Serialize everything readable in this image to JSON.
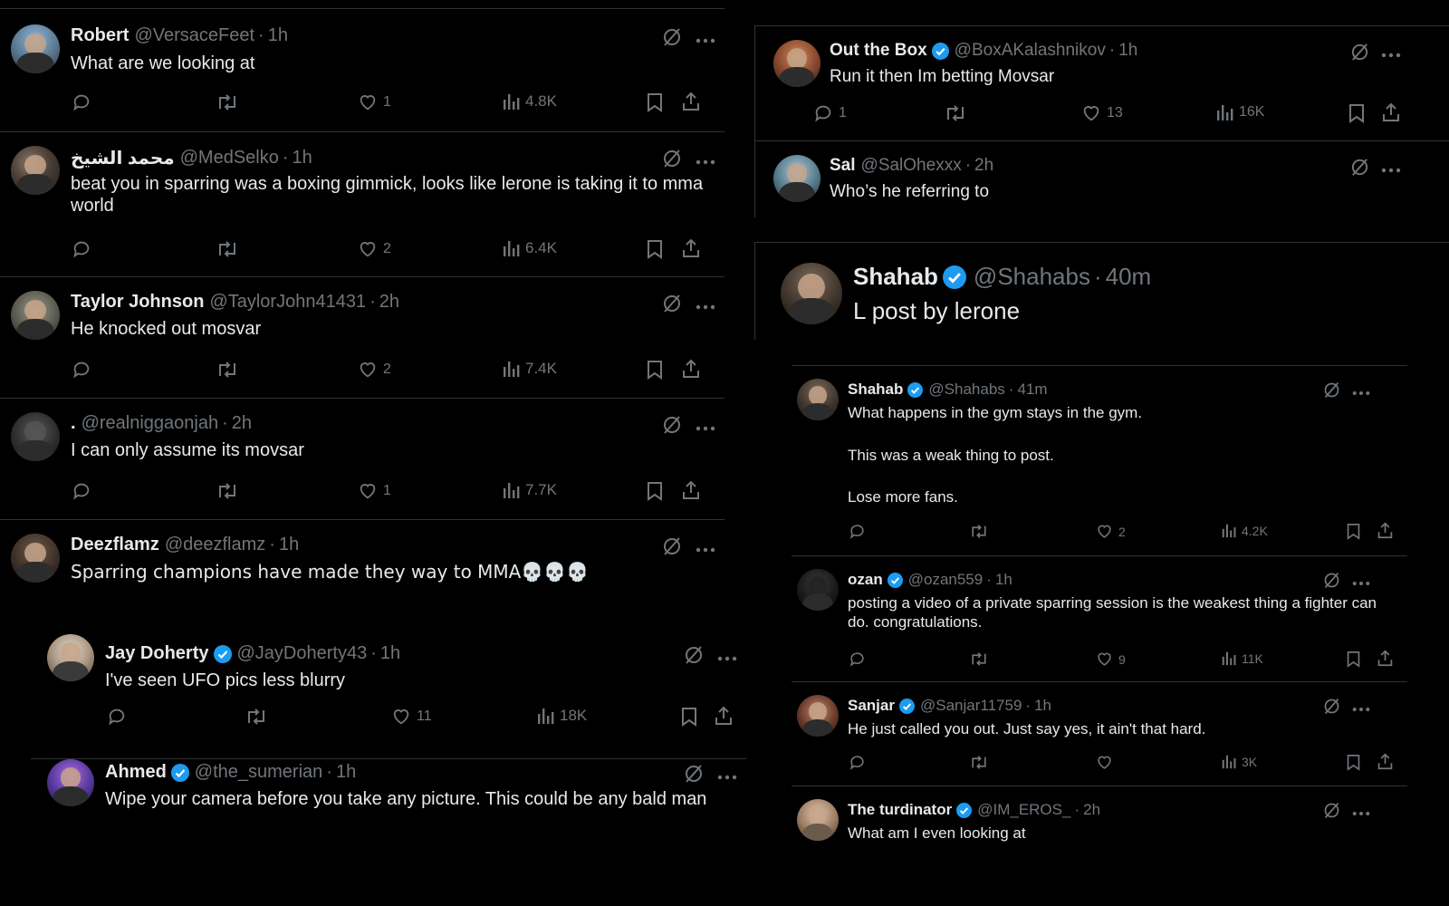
{
  "left_tweets": [
    {
      "name": "Robert",
      "handle": "@VersaceFeet",
      "time": "1h",
      "verified": false,
      "text": "What are we looking at",
      "likes": "1",
      "views": "4.8K"
    },
    {
      "name": "محمد الشيخ",
      "handle": "@MedSelko",
      "time": "1h",
      "verified": false,
      "text": "beat you in sparring was a boxing gimmick, looks like lerone is taking it to mma world",
      "likes": "2",
      "views": "6.4K"
    },
    {
      "name": "Taylor Johnson",
      "handle": "@TaylorJohn41431",
      "time": "2h",
      "verified": false,
      "text": "He knocked out mosvar",
      "likes": "2",
      "views": "7.4K"
    },
    {
      "name": ".",
      "handle": "@realniggaonjah",
      "time": "2h",
      "verified": false,
      "text": "I can only assume its movsar",
      "likes": "1",
      "views": "7.7K"
    },
    {
      "name": "Deezflamz",
      "handle": "@deezflamz",
      "time": "1h",
      "verified": false,
      "text": "Sparring champions have made they way to MMA💀💀💀",
      "likes": "",
      "views": ""
    }
  ],
  "left_nested": [
    {
      "name": "Jay Doherty",
      "handle": "@JayDoherty43",
      "time": "1h",
      "verified": true,
      "text": "I've seen UFO pics less blurry",
      "likes": "11",
      "views": "18K"
    },
    {
      "name": "Ahmed",
      "handle": "@the_sumerian",
      "time": "1h",
      "verified": true,
      "text": "Wipe your camera before you take any picture. This could be any bald man",
      "likes": "",
      "views": ""
    }
  ],
  "right_top": [
    {
      "name": "Out the Box",
      "handle": "@BoxAKalashnikov",
      "time": "1h",
      "verified": true,
      "text": "Run it then Im betting Movsar",
      "replies": "1",
      "likes": "13",
      "views": "16K"
    },
    {
      "name": "Sal",
      "handle": "@SalOhexxx",
      "time": "2h",
      "verified": false,
      "text": "Who’s he referring to",
      "replies": "",
      "likes": "",
      "views": ""
    }
  ],
  "main_tweet": {
    "name": "Shahab",
    "handle": "@Shahabs",
    "time": "40m",
    "verified": true,
    "text": "L post by lerone"
  },
  "right_replies": [
    {
      "name": "Shahab",
      "handle": "@Shahabs",
      "time": "41m",
      "verified": true,
      "lines": [
        "What happens in the gym stays in the gym.",
        "This was a weak thing to post.",
        "Lose more fans."
      ],
      "likes": "2",
      "views": "4.2K"
    },
    {
      "name": "ozan",
      "handle": "@ozan559",
      "time": "1h",
      "verified": true,
      "lines": [
        "posting a video of a private sparring session is the weakest thing a fighter can do. congratulations."
      ],
      "likes": "9",
      "views": "11K"
    },
    {
      "name": "Sanjar",
      "handle": "@Sanjar11759",
      "time": "1h",
      "verified": true,
      "lines": [
        "He just called you out. Just say yes, it ain't that hard."
      ],
      "likes": "",
      "views": "3K"
    },
    {
      "name": "The turdinator",
      "handle": "@IM_EROS_",
      "time": "2h",
      "verified": true,
      "lines": [
        "What am I even looking at"
      ],
      "likes": "",
      "views": ""
    }
  ],
  "icons": {
    "reply": "reply-icon",
    "repost": "repost-icon",
    "like": "heart-icon",
    "views": "views-icon",
    "bookmark": "bookmark-icon",
    "share": "share-icon",
    "grok": "grok-icon",
    "more": "more-icon"
  },
  "colors": {
    "background": "#000000",
    "text": "#e7e9ea",
    "muted": "#71767b",
    "verified": "#1d9bf0",
    "divider": "#2f3336"
  }
}
